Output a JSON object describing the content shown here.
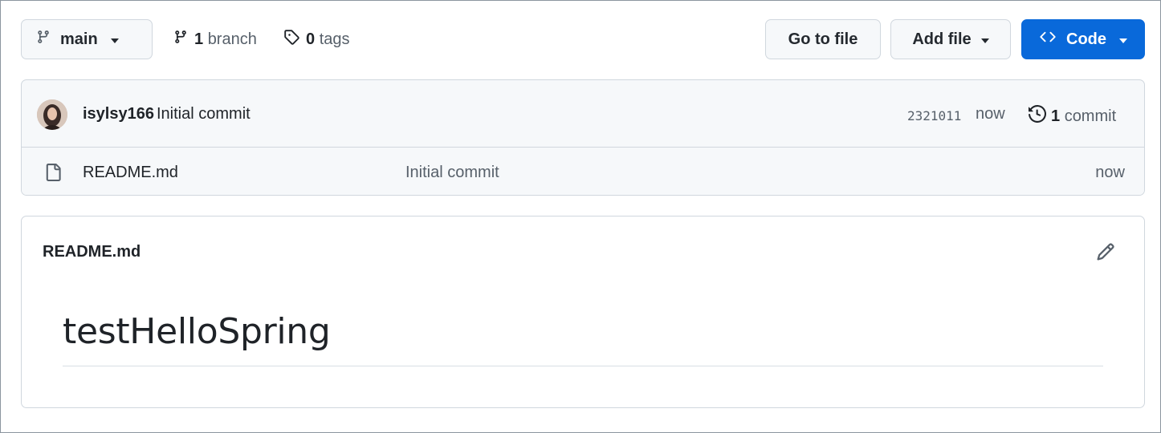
{
  "toolbar": {
    "branch_name": "main",
    "branch_count": "1",
    "branch_word": "branch",
    "tag_count": "0",
    "tag_word": "tags",
    "goto_label": "Go to file",
    "addfile_label": "Add file",
    "code_label": "Code",
    "accent_color": "#0969da"
  },
  "commit": {
    "author": "isylsy166",
    "message": "Initial commit",
    "sha": "2321011",
    "time": "now",
    "count": "1",
    "count_word": "commit"
  },
  "files": [
    {
      "name": "README.md",
      "commit_message": "Initial commit",
      "time": "now",
      "icon": "file-icon"
    }
  ],
  "readme": {
    "title": "README.md",
    "heading": "testHelloSpring"
  },
  "icons": [
    "git-branch-icon",
    "tag-icon",
    "code-icon",
    "history-icon",
    "file-icon",
    "pencil-icon",
    "avatar"
  ]
}
